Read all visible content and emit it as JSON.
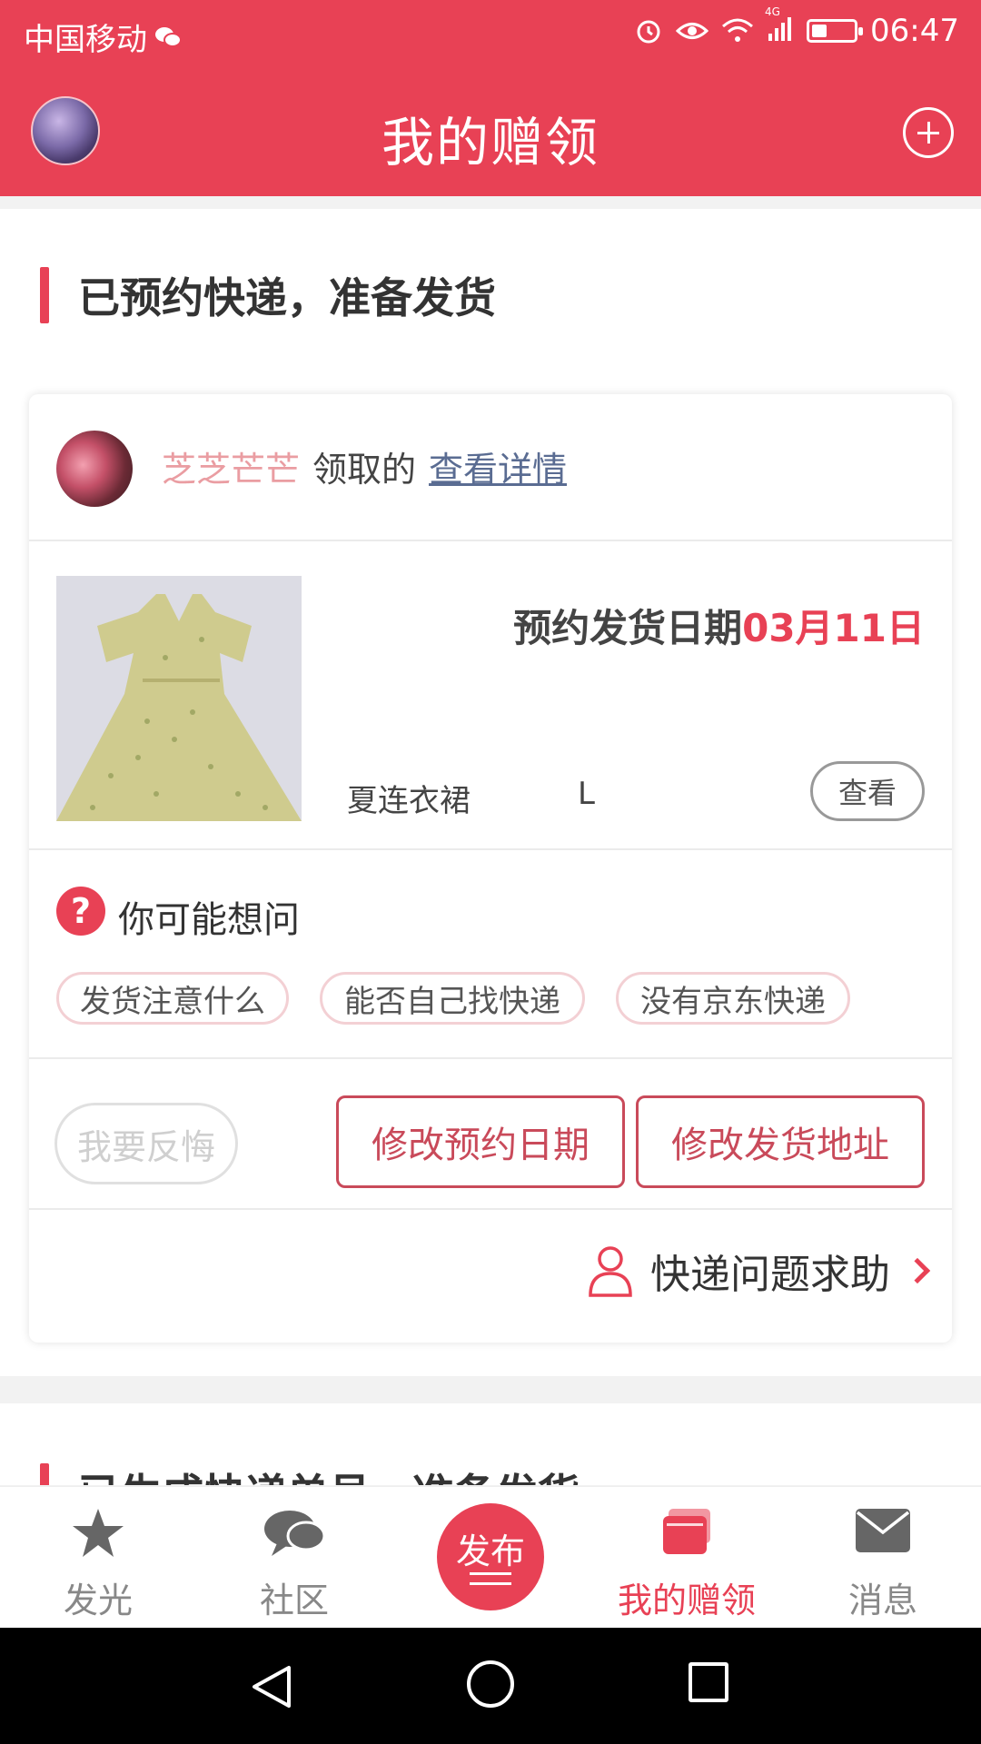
{
  "status": {
    "carrier": "中国移动",
    "network": "4G",
    "time": "06:47"
  },
  "header": {
    "title": "我的赠领"
  },
  "section1": {
    "title": "已预约快递，准备发货",
    "user": {
      "name": "芝芝芒芒",
      "action": "领取的",
      "detail_link": "查看详情"
    },
    "product": {
      "ship_date_label": "预约发货日期",
      "ship_date": "03月11日",
      "name": "夏连衣裙",
      "size": "L",
      "view_btn": "查看"
    },
    "faq": {
      "title": "你可能想问",
      "chips": [
        "发货注意什么",
        "能否自己找快递",
        "没有京东快递"
      ]
    },
    "actions": {
      "regret": "我要反悔",
      "change_date": "修改预约日期",
      "change_address": "修改发货地址"
    },
    "help": "快递问题求助"
  },
  "section2": {
    "title": "已生成快递单号，准备发货"
  },
  "nav": {
    "items": [
      "发光",
      "社区",
      "发布",
      "我的赠领",
      "消息"
    ],
    "active": "我的赠领"
  },
  "colors": {
    "accent": "#e84155",
    "button_border": "#c94a5a"
  }
}
